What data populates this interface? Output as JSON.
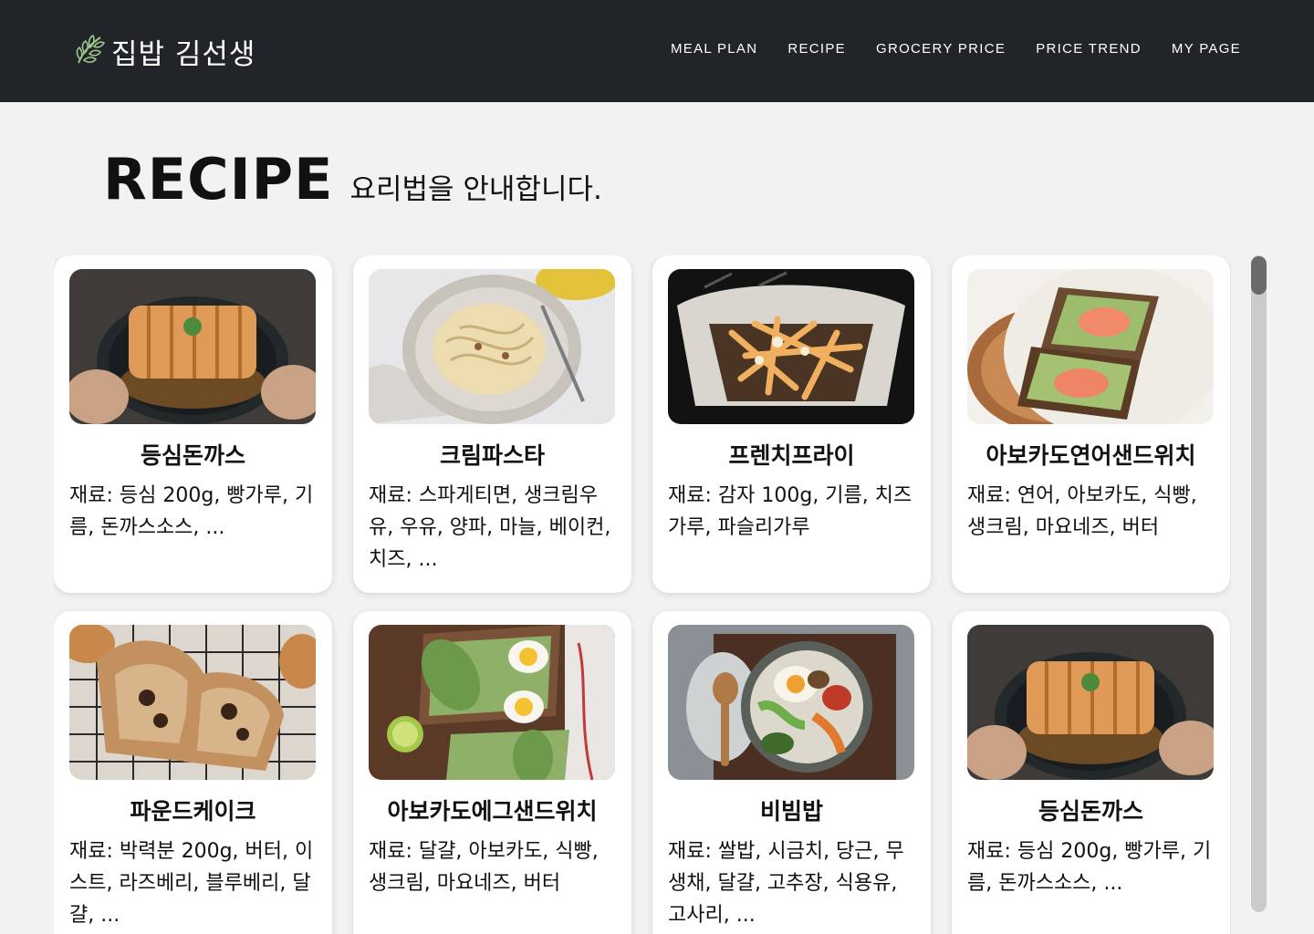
{
  "header": {
    "logo_text": "집밥 김선생",
    "logo_icon": "leaf-icon",
    "nav": [
      "MEAL PLAN",
      "RECIPE",
      "GROCERY PRICE",
      "PRICE TREND",
      "MY PAGE"
    ]
  },
  "heading": {
    "title": "RECIPE",
    "subtitle": "요리법을 안내합니다."
  },
  "recipes": [
    {
      "name": "등심돈까스",
      "ingredients": "재료: 등심 200g, 빵가루, 기름, 돈까스소스, ..."
    },
    {
      "name": "크림파스타",
      "ingredients": "재료: 스파게티면, 생크림우유, 우유, 양파, 마늘, 베이컨, 치즈, ..."
    },
    {
      "name": "프렌치프라이",
      "ingredients": "재료: 감자 100g, 기름, 치즈가루, 파슬리가루"
    },
    {
      "name": "아보카도연어샌드위치",
      "ingredients": "재료: 연어, 아보카도, 식빵, 생크림, 마요네즈, 버터"
    },
    {
      "name": "파운드케이크",
      "ingredients": "재료: 박력분 200g, 버터, 이스트, 라즈베리, 블루베리, 달걀, ..."
    },
    {
      "name": "아보카도에그샌드위치",
      "ingredients": "재료: 달걀, 아보카도, 식빵, 생크림, 마요네즈, 버터"
    },
    {
      "name": "비빔밥",
      "ingredients": "재료: 쌀밥, 시금치, 당근, 무생채, 달걀, 고추장, 식용유, 고사리, ..."
    },
    {
      "name": "등심돈까스",
      "ingredients": "재료: 등심 200g, 빵가루, 기름, 돈까스소스, ..."
    }
  ]
}
